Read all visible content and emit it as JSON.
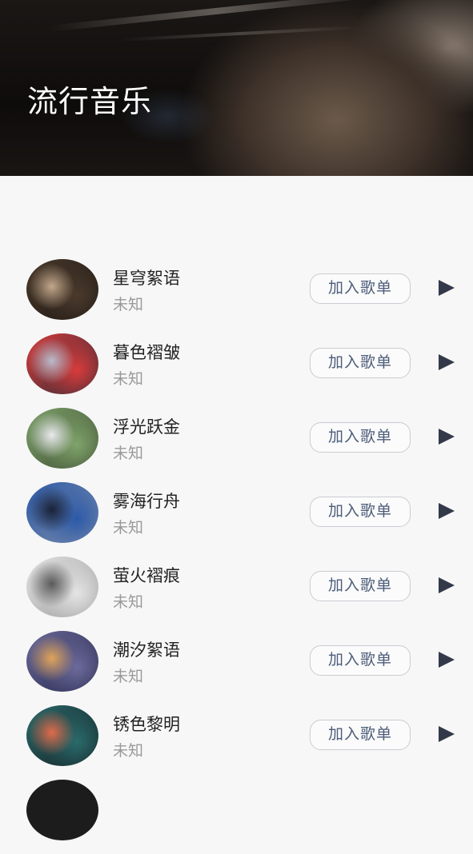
{
  "header": {
    "title": "流行音乐"
  },
  "songs": [
    {
      "title": "星穹絮语",
      "artist": "未知",
      "add_label": "加入歌单",
      "cover_colors": [
        "#4a3a2c",
        "#c2a78a",
        "#1c1612"
      ]
    },
    {
      "title": "暮色褶皱",
      "artist": "未知",
      "add_label": "加入歌单",
      "cover_colors": [
        "#d93b3b",
        "#b9bccb",
        "#2a2c36"
      ]
    },
    {
      "title": "浮光跃金",
      "artist": "未知",
      "add_label": "加入歌单",
      "cover_colors": [
        "#7fa36a",
        "#e9e9ee",
        "#3b4a32"
      ]
    },
    {
      "title": "雾海行舟",
      "artist": "未知",
      "add_label": "加入歌单",
      "cover_colors": [
        "#2c5aa8",
        "#1a2236",
        "#7f8da8"
      ]
    },
    {
      "title": "萤火褶痕",
      "artist": "未知",
      "add_label": "加入歌单",
      "cover_colors": [
        "#e4e4e4",
        "#5a5a5a",
        "#9a9a9a"
      ]
    },
    {
      "title": "潮汐絮语",
      "artist": "未知",
      "add_label": "加入歌单",
      "cover_colors": [
        "#6c6a9a",
        "#e0a45a",
        "#23264a"
      ]
    },
    {
      "title": "锈色黎明",
      "artist": "未知",
      "add_label": "加入歌单",
      "cover_colors": [
        "#2a6b6b",
        "#e06a4a",
        "#141c22"
      ]
    }
  ],
  "partial_cover_color": "#1c1c1c"
}
